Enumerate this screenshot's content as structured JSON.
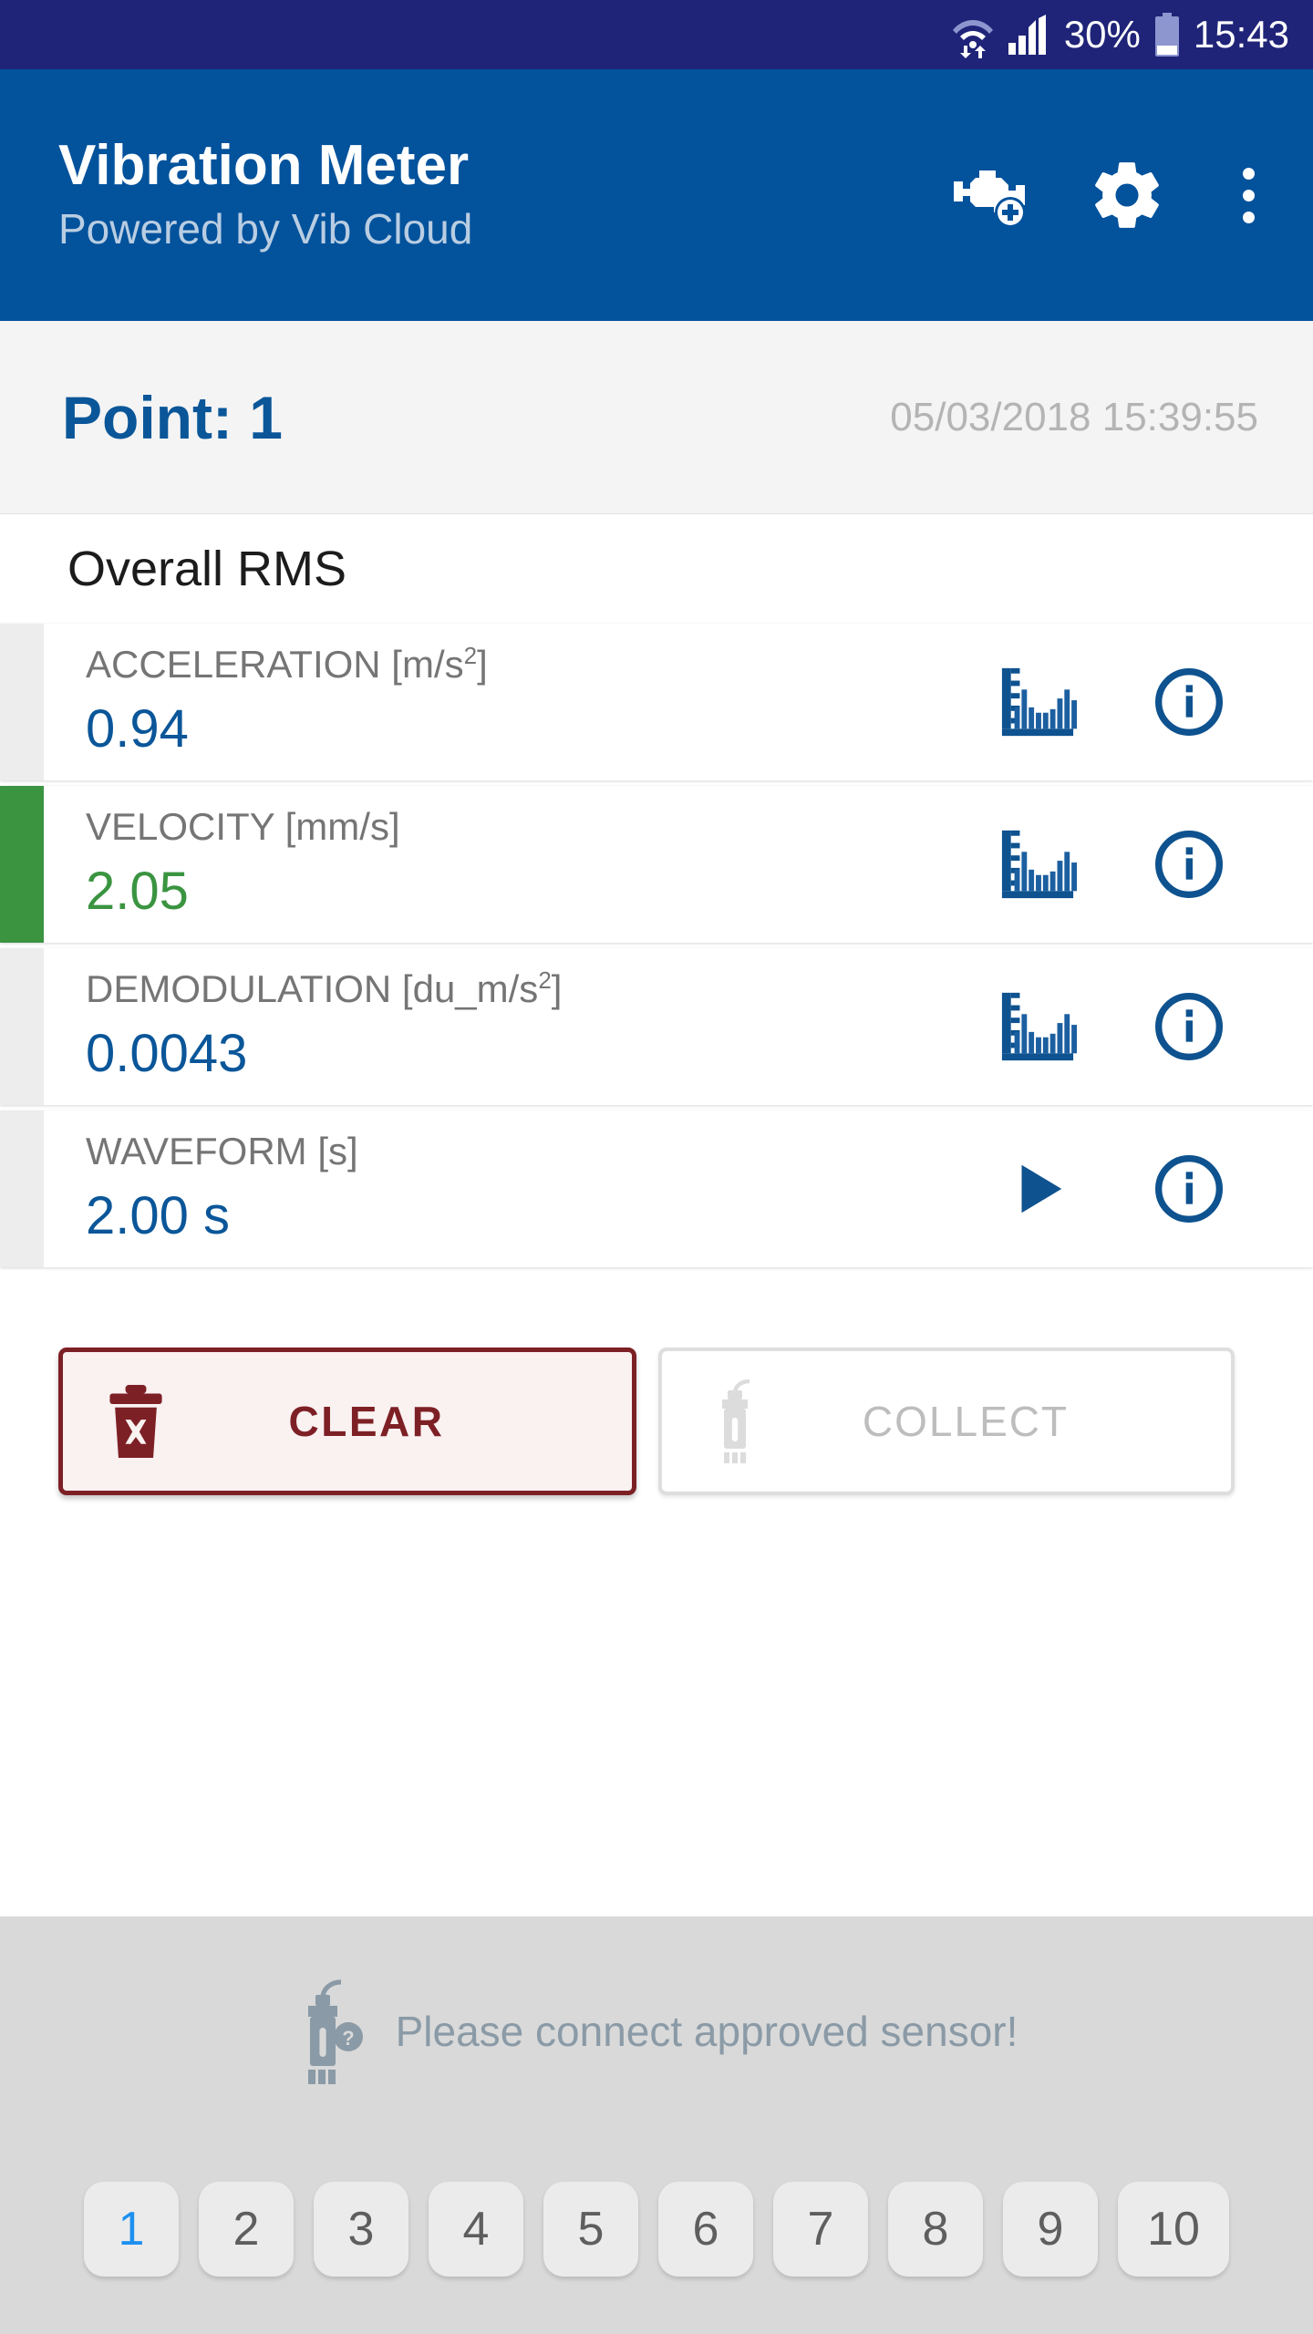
{
  "status_bar": {
    "battery_percent": "30%",
    "clock": "15:43",
    "icons": [
      "wifi-transfer-icon",
      "cellular-signal-icon",
      "battery-icon"
    ]
  },
  "app_bar": {
    "title": "Vibration Meter",
    "subtitle": "Powered by Vib Cloud",
    "actions": [
      {
        "name": "add-machine-icon",
        "label": "Add machine"
      },
      {
        "name": "settings-gear-icon",
        "label": "Settings"
      },
      {
        "name": "overflow-menu-icon",
        "label": "More options"
      }
    ]
  },
  "point_header": {
    "point_label": "Point: 1",
    "timestamp": "05/03/2018 15:39:55"
  },
  "section": {
    "title": "Overall RMS"
  },
  "measurements": [
    {
      "label": "ACCELERATION [m/s",
      "label_sup": "2",
      "label_tail": "]",
      "value": "0.94",
      "accent": "none",
      "value_color": "blue",
      "action_icon": "spectrum-chart-icon",
      "info_icon": "info-icon"
    },
    {
      "label": "VELOCITY [mm/s]",
      "label_sup": "",
      "label_tail": "",
      "value": "2.05",
      "accent": "green",
      "value_color": "green",
      "action_icon": "spectrum-chart-icon",
      "info_icon": "info-icon"
    },
    {
      "label": "DEMODULATION [du_m/s",
      "label_sup": "2",
      "label_tail": "]",
      "value": "0.0043",
      "accent": "none",
      "value_color": "blue",
      "action_icon": "spectrum-chart-icon",
      "info_icon": "info-icon"
    },
    {
      "label": "WAVEFORM [s]",
      "label_sup": "",
      "label_tail": "",
      "value": "2.00 s",
      "accent": "none",
      "value_color": "blue",
      "action_icon": "play-icon",
      "info_icon": "info-icon"
    }
  ],
  "actions": {
    "clear_label": "CLEAR",
    "clear_icon": "trash-delete-icon",
    "collect_label": "COLLECT",
    "collect_icon": "sensor-icon",
    "collect_disabled": true
  },
  "sensor_banner": {
    "message": "Please connect approved sensor!",
    "icon": "sensor-question-icon"
  },
  "pager": {
    "items": [
      "1",
      "2",
      "3",
      "4",
      "5",
      "6",
      "7",
      "8",
      "9",
      "10"
    ],
    "active_index": 0
  },
  "colors": {
    "status_bar": "#1f2478",
    "app_bar": "#02529c",
    "accent_blue": "#0a5699",
    "accent_green": "#3a9440",
    "clear_red": "#7d2025",
    "active_pager": "#1d90f0"
  }
}
